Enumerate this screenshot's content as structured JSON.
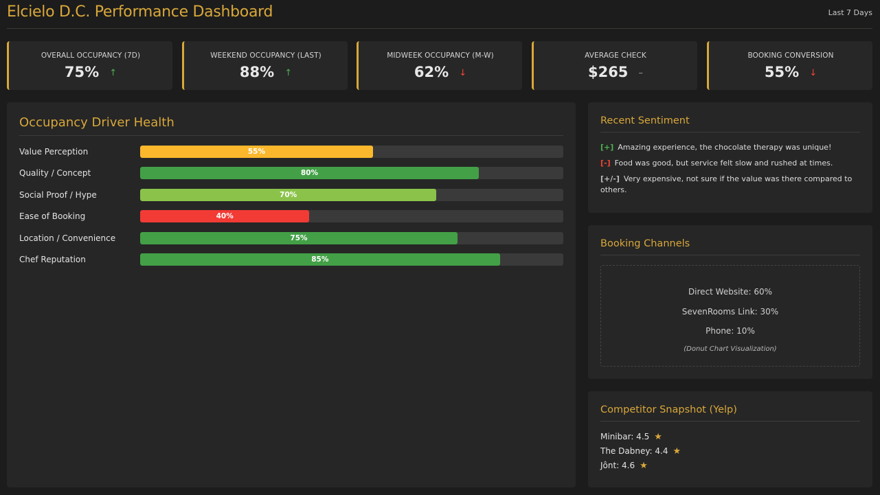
{
  "header": {
    "title": "Elcielo D.C. Performance Dashboard",
    "range": "Last 7 Days"
  },
  "kpis": [
    {
      "label": "OVERALL OCCUPANCY (7D)",
      "value": "75%",
      "trend": "↑",
      "trend_dir": "up"
    },
    {
      "label": "WEEKEND OCCUPANCY (LAST)",
      "value": "88%",
      "trend": "↑",
      "trend_dir": "up"
    },
    {
      "label": "MIDWEEK OCCUPANCY (M-W)",
      "value": "62%",
      "trend": "↓",
      "trend_dir": "down"
    },
    {
      "label": "AVERAGE CHECK",
      "value": "$265",
      "trend": "–",
      "trend_dir": "flat"
    },
    {
      "label": "BOOKING CONVERSION",
      "value": "55%",
      "trend": "↓",
      "trend_dir": "down"
    }
  ],
  "drivers": {
    "title": "Occupancy Driver Health",
    "items": [
      {
        "label": "Value Perception",
        "value": 55,
        "text": "55%",
        "color": "#fbb82d"
      },
      {
        "label": "Quality / Concept",
        "value": 80,
        "text": "80%",
        "color": "#43a047"
      },
      {
        "label": "Social Proof / Hype",
        "value": 70,
        "text": "70%",
        "color": "#8bc34a"
      },
      {
        "label": "Ease of Booking",
        "value": 40,
        "text": "40%",
        "color": "#f23b35"
      },
      {
        "label": "Location / Convenience",
        "value": 75,
        "text": "75%",
        "color": "#43a047"
      },
      {
        "label": "Chef Reputation",
        "value": 85,
        "text": "85%",
        "color": "#43a047"
      }
    ]
  },
  "sentiment": {
    "title": "Recent Sentiment",
    "items": [
      {
        "tag": "[+]",
        "kind": "pos",
        "text": "Amazing experience, the chocolate therapy was unique!"
      },
      {
        "tag": "[-]",
        "kind": "neg",
        "text": "Food was good, but service felt slow and rushed at times."
      },
      {
        "tag": "[+/-]",
        "kind": "mix",
        "text": "Very expensive, not sure if the value was there compared to others."
      }
    ]
  },
  "channels": {
    "title": "Booking Channels",
    "lines": [
      "Direct Website: 60%",
      "SevenRooms Link: 30%",
      "Phone: 10%"
    ],
    "note": "(Donut Chart Visualization)"
  },
  "competitors": {
    "title": "Competitor Snapshot (Yelp)",
    "items": [
      {
        "text": "Minibar: 4.5",
        "star": "★"
      },
      {
        "text": "The Dabney: 4.4",
        "star": "★"
      },
      {
        "text": "Jônt: 4.6",
        "star": "★"
      }
    ]
  },
  "colors": {
    "accent": "#d9a83a",
    "up": "#4caf50",
    "down": "#f44336",
    "panel": "#262626",
    "background": "#1c1c1c"
  }
}
